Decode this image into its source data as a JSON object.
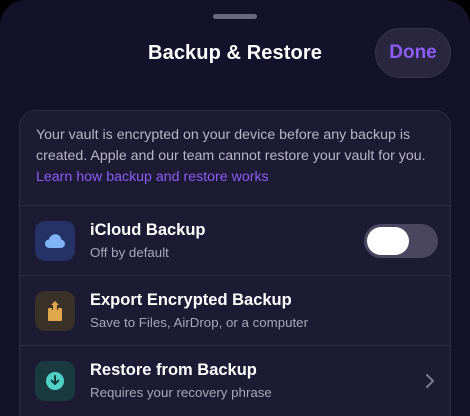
{
  "sheet": {
    "title": "Backup & Restore",
    "done_label": "Done"
  },
  "info": {
    "text": "Your vault is encrypted on your device before any backup is created. Apple and our team cannot restore your vault for you.",
    "link_text": "Learn how backup and restore works"
  },
  "rows": [
    {
      "title": "iCloud Backup",
      "subtitle": "Off by default",
      "icon": "cloud-icon",
      "control": "toggle",
      "toggle_on": false
    },
    {
      "title": "Export Encrypted Backup",
      "subtitle": "Save to Files, AirDrop, or a computer",
      "icon": "share-icon",
      "control": "none"
    },
    {
      "title": "Restore from Backup",
      "subtitle": "Requires your recovery phrase",
      "icon": "download-icon",
      "control": "chevron"
    }
  ],
  "colors": {
    "accent": "#8b5cf6",
    "background": "#14112a",
    "card": "#1d1a33",
    "icloud_tile": "#243266",
    "export_tile": "#3a3129",
    "restore_tile": "#193b3f"
  }
}
